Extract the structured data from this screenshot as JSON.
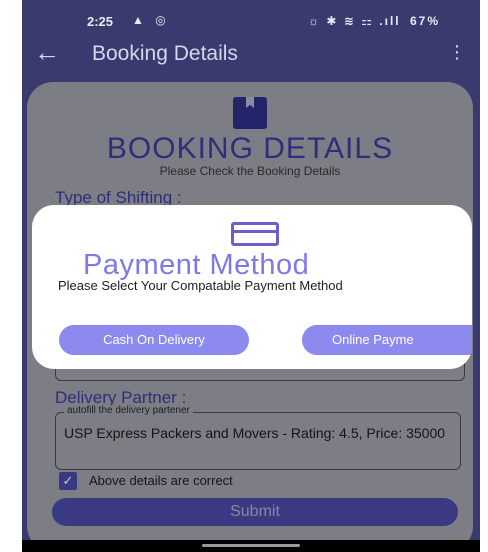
{
  "status_bar": {
    "time": "2:25",
    "left_icons": "▲ ◎",
    "right_icons": "☼ ✱ ≋ ⚏ .ıll",
    "battery": "67%"
  },
  "app_bar": {
    "title": "Booking Details",
    "back_glyph": "←",
    "more_glyph": "⋮"
  },
  "card": {
    "title": "BOOKING DETAILS",
    "subtitle": "Please Check the Booking Details",
    "type_heading": "Type of Shifting :",
    "delivery_heading": "Delivery Partner :",
    "delivery_legend": "autofill the delivery partener",
    "delivery_value": "USP Express Packers and Movers - Rating: 4.5, Price: 35000",
    "confirm_label": "Above details are correct",
    "confirm_checked": true,
    "check_glyph": "✓",
    "submit_label": "Submit"
  },
  "dialog": {
    "title": "Payment Method",
    "subtitle": "Please Select Your Compatable Payment Method",
    "cod_label": "Cash On Delivery",
    "online_label": "Online Payme"
  },
  "colors": {
    "dim_background": "#3a3a6e",
    "card_dimmed": "#7d7d85",
    "accent": "#8c89ef",
    "dialog_title": "#7f79e8"
  },
  "icons": {
    "back": "arrow-left-icon",
    "more": "more-vertical-icon",
    "book": "bookmark-book-icon",
    "payment": "credit-card-icon",
    "check": "checkbox-checked-icon"
  }
}
